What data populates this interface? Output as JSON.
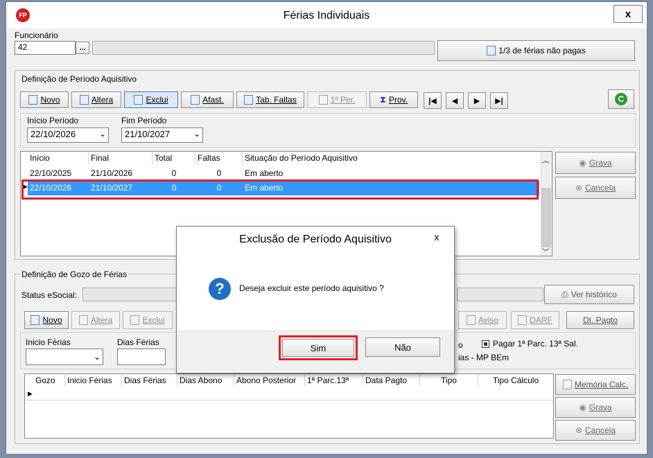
{
  "window": {
    "title": "Férias Individuais",
    "app_icon": "FP",
    "close": "x"
  },
  "funcionario": {
    "label": "Funcionário",
    "code": "42",
    "browse": "...",
    "status_button": "1/3 de férias não pagas"
  },
  "aquisitivo": {
    "group_label": "Definição de Período Aquisitivo",
    "toolbar": [
      "Novo",
      "Altera",
      "Exclui",
      "Afast.",
      "Tab. Faltas",
      "1º Per.",
      "Prov."
    ],
    "inicio_label": "Início Período",
    "fim_label": "Fim Período",
    "inicio_value": "22/10/2026",
    "fim_value": "21/10/2027",
    "columns": [
      "Início",
      "Final",
      "Total",
      "Faltas",
      "Situação do Período Aquisitivo"
    ],
    "rows": [
      [
        "22/10/2025",
        "21/10/2026",
        "0",
        "0",
        "Em aberto"
      ],
      [
        "22/10/2026",
        "21/10/2027",
        "0",
        "0",
        "Em aberto"
      ]
    ],
    "grava": "Grava",
    "cancela": "Cancela"
  },
  "gozo": {
    "group_label": "Definição de Gozo de Férias",
    "status_label": "Status eSocial:",
    "ver_historico": "Ver histórico",
    "toolbar": [
      "Novo",
      "Altera",
      "Exclui"
    ],
    "aviso": "Aviso",
    "darf": "DARF",
    "dt_pagto": "Dt. Pagto",
    "inicio_ferias_label": "Inicio Férias",
    "dias_ferias_label": "Dias Férias",
    "partial_text_1": "o",
    "pagar_13": "Pagar 1ª Parc. 13ª Sal.",
    "partial_text_2": "ias - MP BEm",
    "columns": [
      "Gozo",
      "Inicio Férias",
      "Dias Férias",
      "Dias Abono",
      "Abono Posterior",
      "1ª Parc.13ª",
      "Data Pagto",
      "Tipo",
      "Tipo Cálculo"
    ],
    "memoria_calc": "Memória Calc.",
    "grava": "Grava",
    "cancela": "Cancela"
  },
  "dialog": {
    "title": "Exclusão de Período Aquisitivo",
    "close": "x",
    "message": "Deseja excluir este período aquisitivo ?",
    "yes": "Sim",
    "no": "Não"
  }
}
